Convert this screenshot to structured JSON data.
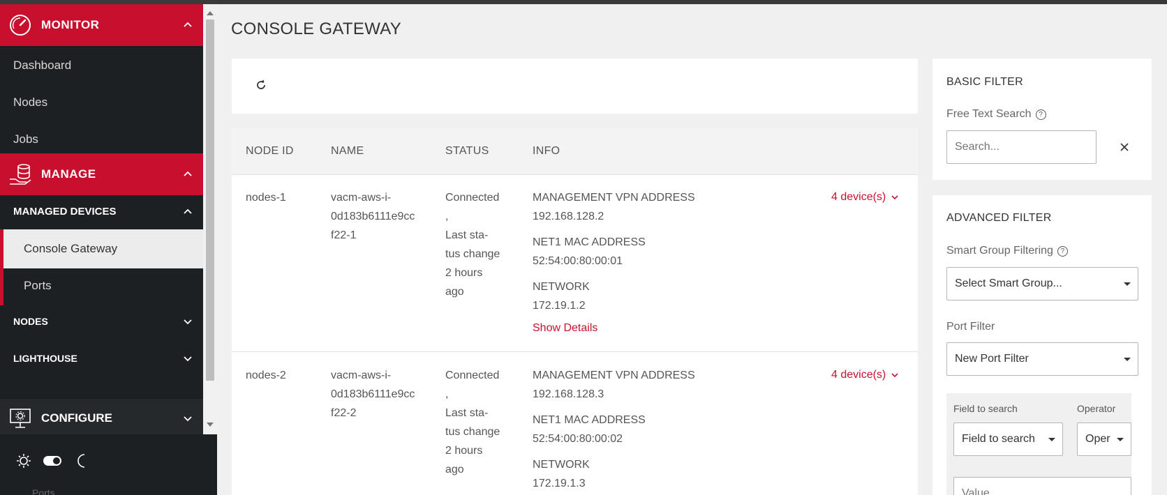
{
  "sidebar": {
    "monitor": {
      "label": "MONITOR",
      "items": [
        "Dashboard",
        "Nodes",
        "Jobs"
      ]
    },
    "manage": {
      "label": "MANAGE"
    },
    "managed_devices": {
      "label": "MANAGED DEVICES",
      "items": [
        "Console Gateway",
        "Ports"
      ]
    },
    "nodes": {
      "label": "NODES"
    },
    "lighthouse": {
      "label": "LIGHTHOUSE"
    },
    "configure": {
      "label": "CONFIGURE"
    }
  },
  "page": {
    "title": "CONSOLE GATEWAY"
  },
  "table": {
    "headers": {
      "node_id": "NODE ID",
      "name": "NAME",
      "status": "STATUS",
      "info": "INFO"
    },
    "rows": [
      {
        "node_id": "nodes-1",
        "name": "vacm-aws-i-\n0d183b6111e9cc\nf22-1",
        "status": "Connected\n,\nLast sta-\ntus change\n2 hours\nago",
        "mgmt_label": "MANAGEMENT VPN ADDRESS",
        "mgmt_value": "192.168.128.2",
        "mac_label": "NET1 MAC ADDRESS",
        "mac_value": "52:54:00:80:00:01",
        "net_label": "NETWORK",
        "net_value": "172.19.1.2",
        "details": "Show Details",
        "devices": "4 device(s)"
      },
      {
        "node_id": "nodes-2",
        "name": "vacm-aws-i-\n0d183b6111e9cc\nf22-2",
        "status": "Connected\n,\nLast sta-\ntus change\n2 hours\nago",
        "mgmt_label": "MANAGEMENT VPN ADDRESS",
        "mgmt_value": "192.168.128.3",
        "mac_label": "NET1 MAC ADDRESS",
        "mac_value": "52:54:00:80:00:02",
        "net_label": "NETWORK",
        "net_value": "172.19.1.3",
        "devices": "4 device(s)"
      }
    ]
  },
  "filters": {
    "basic": {
      "title": "BASIC FILTER",
      "free_text_label": "Free Text Search",
      "free_text_placeholder": "Search..."
    },
    "advanced": {
      "title": "ADVANCED FILTER",
      "smart_group_label": "Smart Group Filtering",
      "smart_group_value": "Select Smart Group...",
      "port_filter_label": "Port Filter",
      "port_filter_value": "New Port Filter",
      "field_label": "Field to search",
      "field_value": "Field to search",
      "operator_label": "Operator",
      "operator_value": "Oper",
      "value_placeholder": "Value"
    }
  },
  "footer_peek": "Ports",
  "colors": {
    "accent": "#c8102e",
    "sidebar_bg": "#1d2022"
  }
}
